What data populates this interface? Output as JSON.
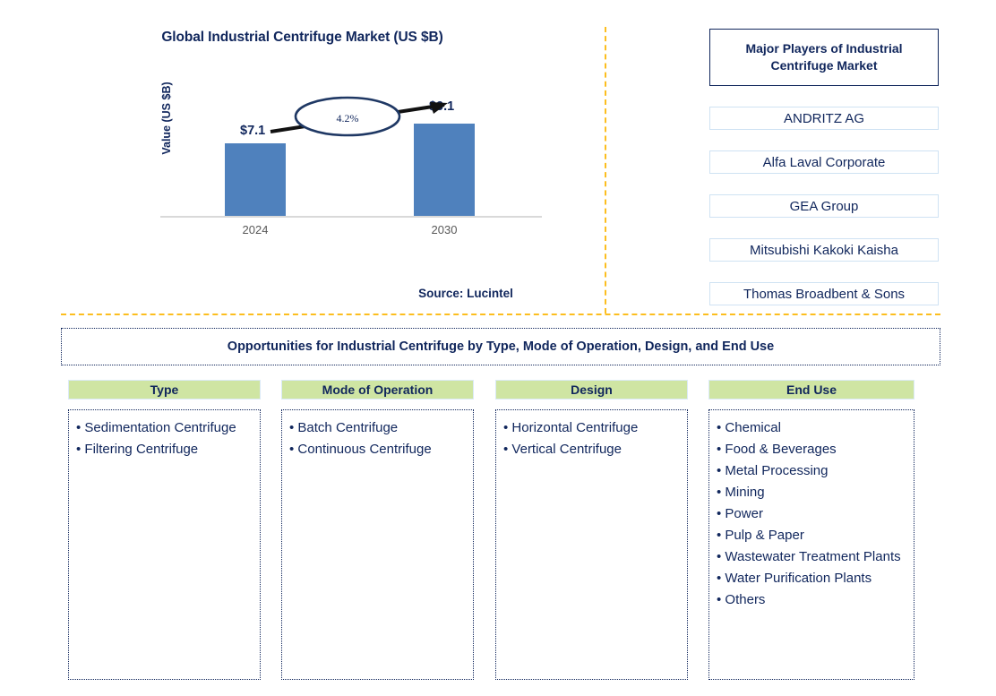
{
  "chart": {
    "title": "Global Industrial Centrifuge Market (US $B)",
    "y_axis_label": "Value (US $B)",
    "source": "Source: Lucintel"
  },
  "chart_data": {
    "type": "bar",
    "title": "Global Industrial Centrifuge Market (US $B)",
    "xlabel": "",
    "ylabel": "Value (US $B)",
    "categories": [
      "2024",
      "2030"
    ],
    "values": [
      7.1,
      9.1
    ],
    "value_labels": [
      "$7.1",
      "$9.1"
    ],
    "unit": "US $B",
    "cagr": "4.2%",
    "annotation": "4.2%",
    "ylim": [
      0,
      10.5
    ],
    "grid": false,
    "legend": "none",
    "bar_color": "#4f81bd",
    "source": "Source: Lucintel"
  },
  "players": {
    "header": "Major Players of Industrial Centrifuge Market",
    "items": [
      "ANDRITZ AG",
      "Alfa Laval Corporate",
      "GEA Group",
      "Mitsubishi Kakoki Kaisha",
      "Thomas Broadbent & Sons"
    ]
  },
  "opportunities": {
    "banner": "Opportunities for Industrial Centrifuge by Type, Mode of Operation, Design, and End Use",
    "columns": [
      {
        "header": "Type",
        "items": [
          "Sedimentation Centrifuge",
          "Filtering Centrifuge"
        ]
      },
      {
        "header": "Mode of Operation",
        "items": [
          "Batch Centrifuge",
          "Continuous Centrifuge"
        ]
      },
      {
        "header": "Design",
        "items": [
          "Horizontal Centrifuge",
          "Vertical Centrifuge"
        ]
      },
      {
        "header": "End Use",
        "items": [
          "Chemical",
          "Food & Beverages",
          "Metal Processing",
          "Mining",
          "Power",
          "Pulp & Paper",
          "Wastewater Treatment Plants",
          "Water Purification Plants",
          "Others"
        ]
      }
    ]
  },
  "colors": {
    "bar": "#4f81bd",
    "navy": "#10265c",
    "divider": "#fcbe1f",
    "header_green": "#cfe5a3"
  }
}
